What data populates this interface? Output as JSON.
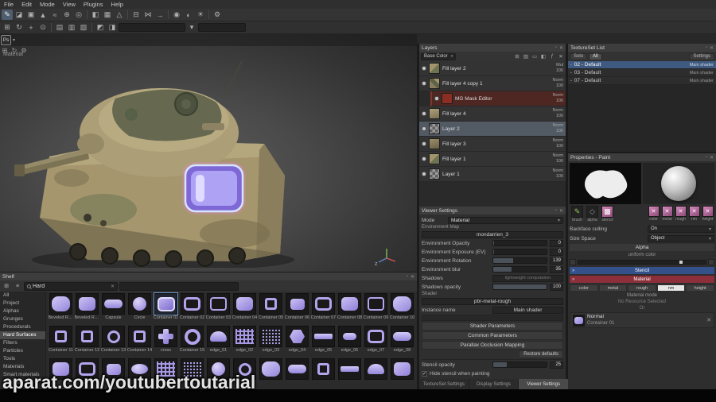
{
  "ui": {
    "dock_glyph": "▫",
    "close_glyph": "✕",
    "dropdown_glyph": "▾",
    "check_glyph": "✓",
    "section_arrow": "»",
    "grid_glyph": "⊞",
    "list_glyph": "≡",
    "row_dot_glyph": "▪"
  },
  "menu_bar": {
    "items": [
      {
        "label": "File"
      },
      {
        "label": "Edit"
      },
      {
        "label": "Mode"
      },
      {
        "label": "View"
      },
      {
        "label": "Plugins"
      },
      {
        "label": "Help"
      }
    ]
  },
  "toolbar_main": {
    "icons": [
      {
        "name": "paint-tool-icon",
        "glyph": "✎",
        "active": true
      },
      {
        "name": "eraser-tool-icon",
        "glyph": "◪"
      },
      {
        "name": "projection-tool-icon",
        "glyph": "▣"
      },
      {
        "name": "polygon-fill-tool-icon",
        "glyph": "▲"
      },
      {
        "name": "smudge-tool-icon",
        "glyph": "≈"
      },
      {
        "name": "clone-tool-icon",
        "glyph": "⊕"
      },
      {
        "name": "material-picker-icon",
        "glyph": "◎"
      },
      {
        "sep": true
      },
      {
        "name": "mask-icon",
        "glyph": "◧"
      },
      {
        "name": "uv-view-icon",
        "glyph": "▦"
      },
      {
        "name": "geometry-icon",
        "glyph": "△"
      },
      {
        "sep": true
      },
      {
        "name": "mirror-icon",
        "glyph": "⊟"
      },
      {
        "name": "symmetry-icon",
        "glyph": "⋈"
      },
      {
        "name": "lazy-mouse-icon",
        "glyph": "→"
      },
      {
        "sep": true
      },
      {
        "name": "camera-icon",
        "glyph": "◉"
      },
      {
        "name": "environment-icon",
        "glyph": "◐"
      },
      {
        "name": "light-icon",
        "glyph": "☀"
      },
      {
        "sep": true
      },
      {
        "name": "viewport-settings-icon",
        "glyph": "⚙"
      }
    ]
  },
  "toolbar_secondary": {
    "icons_a": [
      {
        "name": "select-mode-icon",
        "glyph": "⊞"
      },
      {
        "name": "orbit-camera-icon",
        "glyph": "↻"
      },
      {
        "name": "pan-camera-icon",
        "glyph": "+"
      },
      {
        "name": "zoom-camera-icon",
        "glyph": "⊙"
      },
      {
        "sep": true
      },
      {
        "name": "snap-toggle-icon",
        "glyph": "▤"
      },
      {
        "name": "wireframe-toggle-icon",
        "glyph": "▥"
      },
      {
        "name": "shading-toggle-icon",
        "glyph": "▧"
      },
      {
        "sep": true
      },
      {
        "name": "stencil-toggle-icon",
        "glyph": "◩"
      },
      {
        "name": "quick-mask-icon",
        "glyph": "◨"
      }
    ],
    "icons_b": [
      {
        "name": "filter-dropdown-icon",
        "glyph": "▾"
      }
    ],
    "field_value": "",
    "field2_value": ""
  },
  "ps_cluster": {
    "badge": "Ps",
    "caret": "▾",
    "icons": [
      {
        "name": "add-resource-icon",
        "glyph": "⊞"
      },
      {
        "name": "refresh-icon",
        "glyph": "↻"
      },
      {
        "name": "shelf-settings-icon",
        "glyph": "⚙"
      }
    ]
  },
  "viewport": {
    "mode_label": "Material",
    "axis_z": "z"
  },
  "layers_panel": {
    "title": "Layers",
    "blend_channel": "Base Color",
    "toolbar_icons": [
      {
        "name": "add-layer-icon",
        "glyph": "⊞"
      },
      {
        "name": "add-fill-layer-icon",
        "glyph": "▨"
      },
      {
        "name": "add-folder-icon",
        "glyph": "▭"
      },
      {
        "name": "add-mask-icon",
        "glyph": "◧"
      },
      {
        "name": "add-effect-icon",
        "glyph": "ƒ"
      },
      {
        "name": "delete-layer-icon",
        "glyph": "✕"
      }
    ],
    "rows": [
      {
        "name": "Fill layer 2",
        "blend": "Mul",
        "opacity": "100",
        "thumb": "camo"
      },
      {
        "name": "Fill layer 4 copy 1",
        "blend": "Norm",
        "opacity": "100",
        "thumb": "camo2"
      },
      {
        "name": "MG Mask Editor",
        "blend": "Norm",
        "opacity": "100",
        "thumb": "red",
        "child": true
      },
      {
        "name": "Fill layer 4",
        "blend": "Norm",
        "opacity": "100",
        "thumb": "tan"
      },
      {
        "name": "Layer 2",
        "blend": "Norm",
        "opacity": "100",
        "thumb": "checker",
        "selected": true
      },
      {
        "name": "Fill layer 3",
        "blend": "Norm",
        "opacity": "100",
        "thumb": "tan2"
      },
      {
        "name": "Fill layer 1",
        "blend": "Norm",
        "opacity": "100",
        "thumb": "camo"
      },
      {
        "name": "Layer 1",
        "blend": "Norm",
        "opacity": "100",
        "thumb": "checker"
      }
    ]
  },
  "viewer_settings": {
    "title": "Viewer Settings",
    "mode_label": "Mode",
    "mode_value": "Material",
    "env_map_label": "Environment Map",
    "env_map_value": "mondarrien_3",
    "sliders": [
      {
        "label": "Environment Opacity",
        "value": "0",
        "fill": 2
      },
      {
        "label": "Environment Exposure (EV)",
        "value": "0",
        "fill": 2
      },
      {
        "label": "Environment Rotation",
        "value": "139",
        "fill": 38
      },
      {
        "label": "Environment blur",
        "value": "35",
        "fill": 35
      }
    ],
    "shadows_label": "Shadows",
    "shadows_hint": "lightweight computation",
    "shadows_opacity": {
      "label": "Shadows opacity",
      "value": "100",
      "fill": 100
    },
    "shader_label": "Shader",
    "shader_value": "pbr-metal-rough",
    "instance_label": "Instance name",
    "instance_value": "Main shader",
    "sections": [
      {
        "label": "Shader Parameters"
      },
      {
        "label": "Common Parameters"
      },
      {
        "label": "Parallax Occlusion Mapping"
      }
    ],
    "restore_label": "Restore defaults",
    "stencil_opacity": {
      "label": "Stencil opacity",
      "value": "25",
      "fill": 25
    },
    "hide_stencil_label": "Hide stencil when painting"
  },
  "bottom_tabs": {
    "tabs": [
      {
        "label": "TextureSet Settings",
        "name": "tab-textureset-settings"
      },
      {
        "label": "Display Settings",
        "name": "tab-display-settings"
      },
      {
        "label": "Viewer Settings",
        "name": "tab-viewer-settings",
        "active": true
      }
    ]
  },
  "textureset_list": {
    "title": "TextureSet List",
    "solo_label": "Solo",
    "all_label": "All",
    "settings_label": "Settings",
    "rows": [
      {
        "name": "02 - Default",
        "shader": "Main shader",
        "selected": true
      },
      {
        "name": "03 - Default",
        "shader": "Main shader"
      },
      {
        "name": "07 - Default",
        "shader": "Main shader"
      }
    ]
  },
  "properties": {
    "title": "Properties - Paint",
    "tools": [
      {
        "label": "brush",
        "kind": "brush",
        "glyph": "✎"
      },
      {
        "label": "alpha",
        "kind": "dark",
        "glyph": "◇"
      },
      {
        "label": "stencil",
        "kind": "pink",
        "glyph": "▩"
      }
    ],
    "channels": [
      {
        "label": "color"
      },
      {
        "label": "metal"
      },
      {
        "label": "rough"
      },
      {
        "label": "nm"
      },
      {
        "label": "height"
      }
    ],
    "channel_x": "✕",
    "backface_label": "Backface culling",
    "backface_value": "On",
    "sizespace_label": "Size Space",
    "sizespace_value": "Object",
    "alpha_title": "Alpha",
    "alpha_hint": "uniform color",
    "stencil_title": "Stencil",
    "material_title": "Material",
    "chips": [
      {
        "label": "color"
      },
      {
        "label": "metal"
      },
      {
        "label": "rough"
      },
      {
        "label": "nm",
        "selected": true
      },
      {
        "label": "height"
      }
    ],
    "material_mode": "Material mode",
    "no_resource": "No Resource Selected",
    "or_label": "Or",
    "resource": {
      "title": "Normal",
      "value": "Container 01"
    }
  },
  "shelf": {
    "title": "Shelf",
    "search_value": "Hard",
    "categories": [
      {
        "label": "All"
      },
      {
        "label": "Project"
      },
      {
        "label": "Alphas"
      },
      {
        "label": "Grunges"
      },
      {
        "label": "Procedurals"
      },
      {
        "label": "Hard Surfaces",
        "selected": true
      },
      {
        "label": "Filters"
      },
      {
        "label": "Particles"
      },
      {
        "label": "Tools"
      },
      {
        "label": "Materials"
      },
      {
        "label": "Smart materials"
      },
      {
        "label": "Emissive"
      }
    ],
    "items": [
      {
        "label": "Beveled Rec...",
        "shape": "rrect-lg"
      },
      {
        "label": "Beveled Rec...",
        "shape": "rrect"
      },
      {
        "label": "Capsule",
        "shape": "pill"
      },
      {
        "label": "Circle",
        "shape": "circle"
      },
      {
        "label": "Container 01",
        "shape": "rrect-border",
        "selected": true
      },
      {
        "label": "Container 02",
        "shape": "rrect-o"
      },
      {
        "label": "Container 03",
        "shape": "rrect-o2"
      },
      {
        "label": "Container 04",
        "shape": "rrect"
      },
      {
        "label": "Container 05",
        "shape": "square-o"
      },
      {
        "label": "Container 06",
        "shape": "rrect-sm"
      },
      {
        "label": "Container 07",
        "shape": "rrect-o"
      },
      {
        "label": "Container 08",
        "shape": "rrect"
      },
      {
        "label": "Container 09",
        "shape": "rrect-o2"
      },
      {
        "label": "Container 10",
        "shape": "rrect-lg"
      },
      {
        "label": "Container 11",
        "shape": "square-o"
      },
      {
        "label": "Container 12",
        "shape": "square-o"
      },
      {
        "label": "Container 13",
        "shape": "ring"
      },
      {
        "label": "Container 14",
        "shape": "square-o"
      },
      {
        "label": "cross",
        "shape": "cross"
      },
      {
        "label": "Container 15",
        "shape": "ring-lg"
      },
      {
        "label": "edge_01",
        "shape": "dome"
      },
      {
        "label": "edge_02",
        "shape": "grid"
      },
      {
        "label": "edge_03",
        "shape": "dots"
      },
      {
        "label": "edge_04",
        "shape": "hex"
      },
      {
        "label": "edge_05",
        "shape": "bar"
      },
      {
        "label": "edge_06",
        "shape": "pill-sm"
      },
      {
        "label": "edge_07",
        "shape": "rrect-o"
      },
      {
        "label": "edge_08",
        "shape": "pill"
      },
      {
        "label": "",
        "shape": "rrect"
      },
      {
        "label": "",
        "shape": "rrect-o"
      },
      {
        "label": "",
        "shape": "rrect-sm"
      },
      {
        "label": "",
        "shape": "oval"
      },
      {
        "label": "",
        "shape": "grid"
      },
      {
        "label": "",
        "shape": "dots"
      },
      {
        "label": "",
        "shape": "circle"
      },
      {
        "label": "",
        "shape": "ring"
      },
      {
        "label": "",
        "shape": "rrect-lg"
      },
      {
        "label": "",
        "shape": "pill"
      },
      {
        "label": "",
        "shape": "square-o"
      },
      {
        "label": "",
        "shape": "bar"
      },
      {
        "label": "",
        "shape": "dome"
      },
      {
        "label": "",
        "shape": "rrect"
      }
    ]
  },
  "watermark": {
    "text": "aparat.com/youtubertoutarial"
  }
}
